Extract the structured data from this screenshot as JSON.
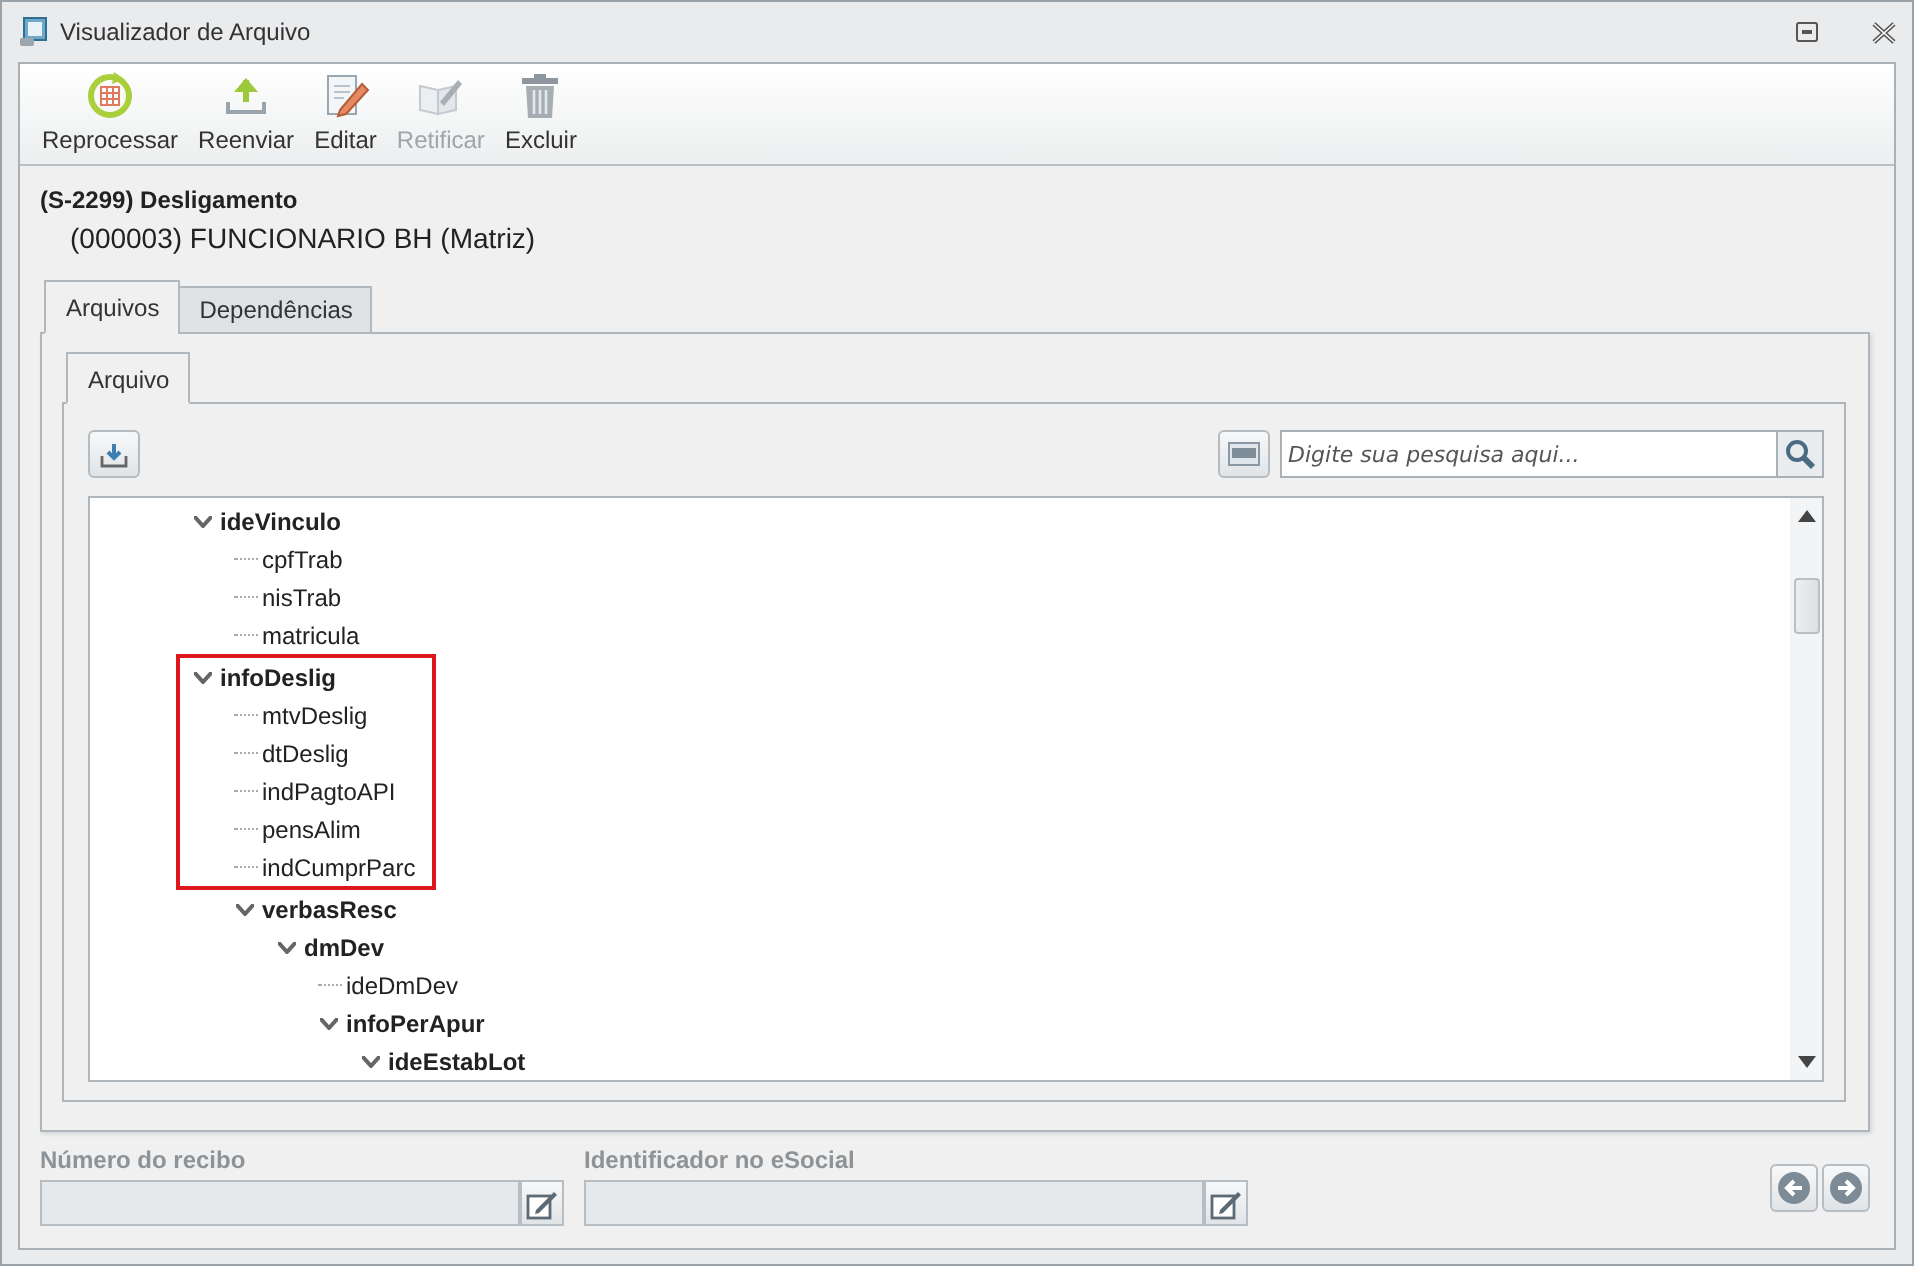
{
  "window": {
    "title": "Visualizador de Arquivo"
  },
  "toolbar": [
    {
      "label": "Reprocessar",
      "kind": "reprocess",
      "disabled": false
    },
    {
      "label": "Reenviar",
      "kind": "upload",
      "disabled": false
    },
    {
      "label": "Editar",
      "kind": "edit",
      "disabled": false
    },
    {
      "label": "Retificar",
      "kind": "rectify",
      "disabled": true
    },
    {
      "label": "Excluir",
      "kind": "delete",
      "disabled": false
    }
  ],
  "event_title": "(S-2299) Desligamento",
  "employee": "(000003) FUNCIONARIO BH (Matriz)",
  "tabs": [
    {
      "label": "Arquivos",
      "selected": true
    },
    {
      "label": "Dependências",
      "selected": false
    }
  ],
  "inner_tabs": [
    {
      "label": "Arquivo",
      "selected": true
    }
  ],
  "search": {
    "placeholder": "Digite sua pesquisa aqui..."
  },
  "tree": [
    {
      "label": "ideVinculo",
      "expanded": true,
      "highlighted": false,
      "children": [
        {
          "label": "cpfTrab"
        },
        {
          "label": "nisTrab"
        },
        {
          "label": "matricula"
        }
      ]
    },
    {
      "label": "infoDeslig",
      "expanded": true,
      "highlighted": true,
      "children": [
        {
          "label": "mtvDeslig"
        },
        {
          "label": "dtDeslig"
        },
        {
          "label": "indPagtoAPI"
        },
        {
          "label": "pensAlim"
        },
        {
          "label": "indCumprParc"
        },
        {
          "label": "verbasResc",
          "expanded": true,
          "highlighted": false,
          "children": [
            {
              "label": "dmDev",
              "expanded": true,
              "highlighted": false,
              "children": [
                {
                  "label": "ideDmDev"
                },
                {
                  "label": "infoPerApur",
                  "expanded": true,
                  "highlighted": false,
                  "children": [
                    {
                      "label": "ideEstabLot",
                      "expanded": true,
                      "highlighted": false
                    }
                  ]
                }
              ]
            }
          ]
        }
      ]
    }
  ],
  "fields": [
    {
      "label": "Número do recibo"
    },
    {
      "label": "Identificador no eSocial"
    }
  ]
}
